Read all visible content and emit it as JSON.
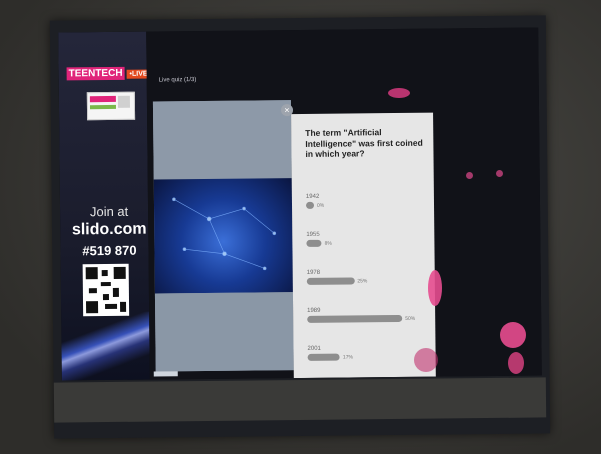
{
  "brand": {
    "teen": "TEENTECH",
    "live": "•LIVE"
  },
  "sidebar": {
    "join_label": "Join at",
    "join_site": "slido.com",
    "join_code": "#519 870"
  },
  "quiz": {
    "tab_label": "Live quiz (1/3)",
    "question": "The term \"Artificial Intelligence\" was first coined in which year?",
    "options": [
      {
        "year": "1942",
        "percent": 0,
        "label": "0%"
      },
      {
        "year": "1955",
        "percent": 8,
        "label": "8%"
      },
      {
        "year": "1978",
        "percent": 25,
        "label": "25%"
      },
      {
        "year": "1989",
        "percent": 50,
        "label": "50%"
      },
      {
        "year": "2001",
        "percent": 17,
        "label": "17%"
      }
    ]
  },
  "colors": {
    "accent_pink": "#e0247a",
    "live_orange": "#e34a1f",
    "poll_bg": "#e6e6e6",
    "bar": "#8e8e8e"
  },
  "icons": {
    "close": "close-icon",
    "qr": "qr-code-icon"
  }
}
